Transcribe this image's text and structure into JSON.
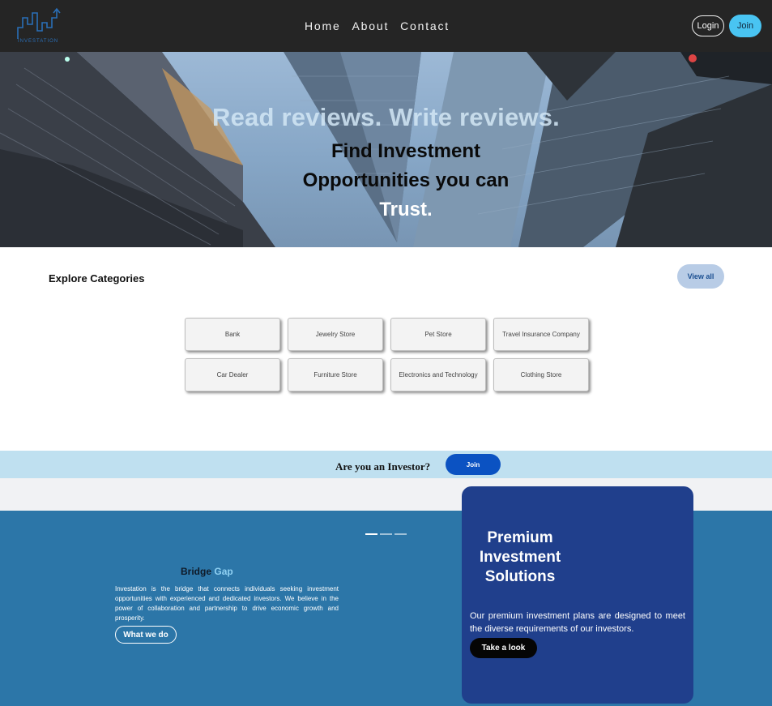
{
  "nav": {
    "logo_text": "INVESTATION",
    "links": [
      "Home",
      "About",
      "Contact"
    ],
    "login_label": "Login",
    "join_label": "Join"
  },
  "hero": {
    "tagline": "Read reviews. Write reviews.",
    "title_line1": "Find Investment",
    "title_line2": "Opportunities you can",
    "title_line3": "Trust."
  },
  "categories": {
    "heading": "Explore Categories",
    "view_all_label": "View all",
    "items": [
      "Bank",
      "Jewelry Store",
      "Pet Store",
      "Travel Insurance Company",
      "Car Dealer",
      "Furniture Store",
      "Electronics and Technology",
      "Clothing Store"
    ]
  },
  "investor_strip": {
    "question": "Are you an Investor?",
    "join_label": "Join"
  },
  "bridge": {
    "title_part1": "Bridge",
    "title_part2": "Gap",
    "text": "Investation is the bridge that connects individuals seeking investment opportunities with experienced and dedicated investors. We believe in the power of collaboration and partnership to drive economic growth and prosperity.",
    "button_label": "What we do"
  },
  "premium": {
    "title": "Premium Investment Solutions",
    "text": "Our premium investment plans are designed to meet the diverse requirements of our investors.",
    "button_label": "Take a look"
  },
  "colors": {
    "nav_bg": "#252525",
    "accent_cyan": "#49c4f2",
    "investor_strip_bg": "#bfe0f0",
    "strip_join_bg": "#0b52c2",
    "lower_bg": "#2c76a8",
    "premium_card_bg": "#203f8c"
  }
}
